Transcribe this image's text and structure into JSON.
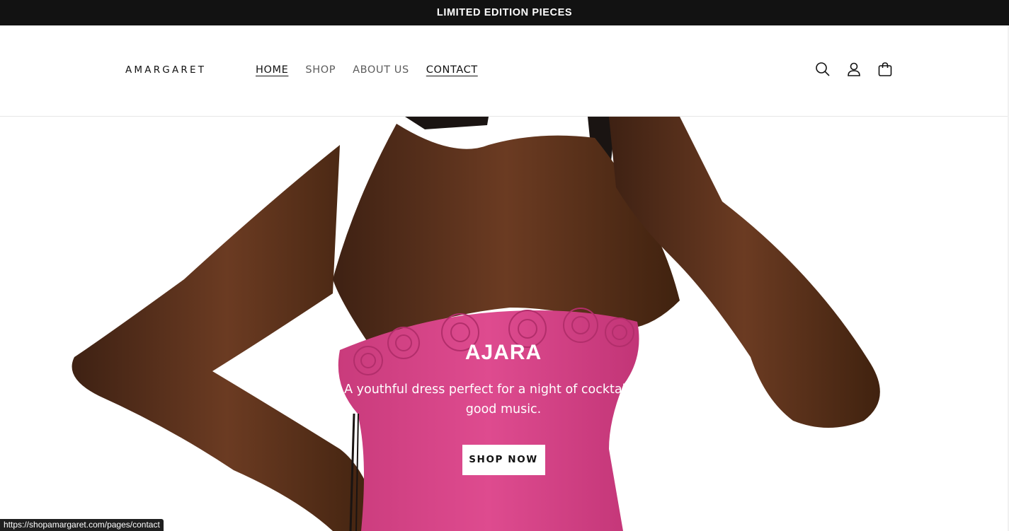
{
  "announcement": {
    "text": "LIMITED EDITION PIECES"
  },
  "header": {
    "logo": "AMARGARET",
    "nav": [
      {
        "label": "HOME",
        "active": true
      },
      {
        "label": "SHOP",
        "active": false
      },
      {
        "label": "ABOUT US",
        "active": false
      },
      {
        "label": "CONTACT",
        "active": true
      }
    ],
    "icons": [
      "search-icon",
      "account-icon",
      "cart-icon"
    ]
  },
  "hero": {
    "title": "AJARA",
    "subtitle": "A youthful dress perfect for a night of cocktails and good music.",
    "button_label": "SHOP NOW",
    "colors": {
      "skin": "#5a321d",
      "dress": "#d9468a",
      "hair": "#1a1412"
    }
  },
  "status_bar": {
    "url": "https://shopamargaret.com/pages/contact"
  }
}
